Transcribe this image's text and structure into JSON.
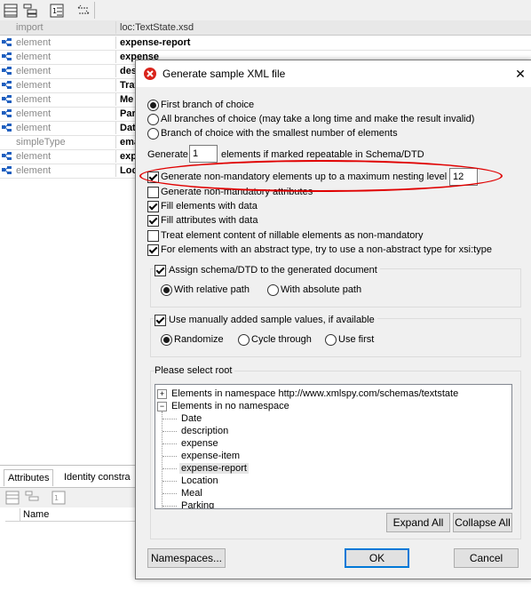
{
  "grid": {
    "header_kind": "import",
    "header_name": "loc:TextState.xsd",
    "rows": [
      {
        "kind": "element",
        "name": "expense-report"
      },
      {
        "kind": "element",
        "name": "expense"
      },
      {
        "kind": "element",
        "name": "des"
      },
      {
        "kind": "element",
        "name": "Trav"
      },
      {
        "kind": "element",
        "name": "Me"
      },
      {
        "kind": "element",
        "name": "Par"
      },
      {
        "kind": "element",
        "name": "Dat"
      },
      {
        "kind": "simpleType",
        "name": "ema"
      },
      {
        "kind": "element",
        "name": "exp"
      },
      {
        "kind": "element",
        "name": "Loc"
      }
    ]
  },
  "bottom_panel": {
    "tab_attributes": "Attributes",
    "tab_identity": "Identity constra",
    "col_name": "Name"
  },
  "dialog": {
    "title": "Generate sample XML file",
    "close_glyph": "✕",
    "radio_choice": [
      {
        "label": "First branch of choice",
        "selected": true
      },
      {
        "label": "All branches of choice (may take a long time and make the result invalid)",
        "selected": false
      },
      {
        "label": "Branch of choice with the smallest number of elements",
        "selected": false
      }
    ],
    "generate_label": "Generate",
    "generate_count": "1",
    "generate_suffix": "elements if marked repeatable in Schema/DTD",
    "checks": [
      {
        "label": "Generate non-mandatory elements up to a maximum nesting level of:",
        "checked": true
      },
      {
        "label": "Generate non-mandatory attributes",
        "checked": false
      },
      {
        "label": "Fill elements with data",
        "checked": true
      },
      {
        "label": "Fill attributes with data",
        "checked": true
      },
      {
        "label": "Treat element content of nillable elements as non-mandatory",
        "checked": false
      },
      {
        "label": "For elements with an abstract type, try to use a non-abstract type for xsi:type",
        "checked": true
      }
    ],
    "nesting_level": "12",
    "assign": {
      "label": "Assign schema/DTD to the generated document",
      "checked": true,
      "opt_relative": "With relative path",
      "opt_absolute": "With absolute path",
      "selected": "relative"
    },
    "sample": {
      "label": "Use manually added sample values, if available",
      "checked": true,
      "opt_randomize": "Randomize",
      "opt_cycle": "Cycle through",
      "opt_first": "Use first",
      "selected": "randomize"
    },
    "root": {
      "label": "Please select root",
      "ns1": "Elements in namespace http://www.xmlspy.com/schemas/textstate",
      "ns2": "Elements in no namespace",
      "items": [
        "Date",
        "description",
        "expense",
        "expense-item",
        "expense-report",
        "Location",
        "Meal",
        "Parking"
      ],
      "selected": "expense-report"
    },
    "buttons": {
      "expand_all": "Expand All",
      "collapse_all": "Collapse All",
      "namespaces": "Namespaces...",
      "ok": "OK",
      "cancel": "Cancel"
    }
  },
  "colors": {
    "annotation_ellipse": "#e00000",
    "dialog_icon": "#d9241c",
    "element_icon": "#1f5fbf"
  }
}
